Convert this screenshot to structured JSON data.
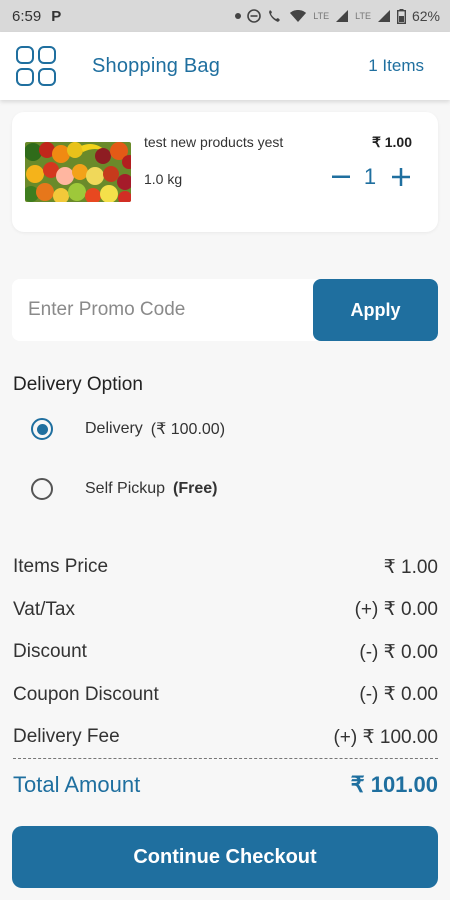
{
  "status_bar": {
    "time": "6:59",
    "app_icon": "P",
    "battery": "62%",
    "network_labels": [
      "LTE",
      "LTE"
    ]
  },
  "header": {
    "title": "Shopping Bag",
    "item_count": "1 Items",
    "menu_icon": "grid-menu-icon"
  },
  "cart": {
    "items": [
      {
        "name": "test new products yest",
        "weight": "1.0 kg",
        "price": "₹ 1.00",
        "quantity": "1",
        "image": "mixed-fruits-image"
      }
    ]
  },
  "promo": {
    "placeholder": "Enter Promo Code",
    "value": "",
    "apply_label": "Apply"
  },
  "delivery": {
    "heading": "Delivery Option",
    "options": [
      {
        "label": "Delivery",
        "fee": "(₹ 100.00)",
        "selected": true
      },
      {
        "label": "Self Pickup",
        "fee": "(Free)",
        "selected": false
      }
    ]
  },
  "summary": {
    "rows": [
      {
        "label": "Items Price",
        "value": "₹ 1.00"
      },
      {
        "label": "Vat/Tax",
        "value": "(+) ₹ 0.00"
      },
      {
        "label": "Discount",
        "value": "(-) ₹ 0.00"
      },
      {
        "label": "Coupon Discount",
        "value": "(-) ₹ 0.00"
      },
      {
        "label": "Delivery Fee",
        "value": "(+) ₹ 100.00"
      }
    ],
    "total_label": "Total Amount",
    "total_value": "₹ 101.00"
  },
  "checkout": {
    "label": "Continue Checkout"
  },
  "colors": {
    "accent": "#1f6f9f",
    "background": "#f7f7f7",
    "card": "#ffffff"
  }
}
